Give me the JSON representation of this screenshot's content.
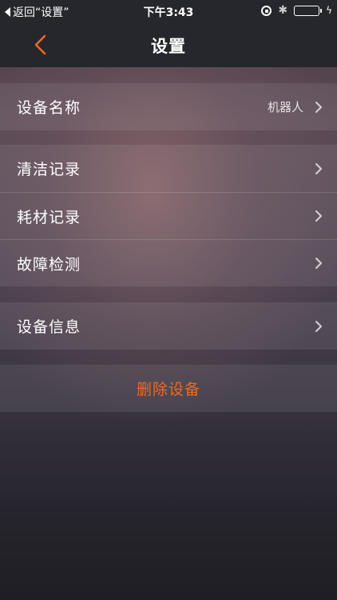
{
  "status_bar": {
    "back_text": "返回“设置”",
    "time": "下午3:43",
    "bluetooth_glyph": "✱",
    "charging_glyph": "ϟ"
  },
  "nav": {
    "title": "设置",
    "back_icon": "chevron-left-icon",
    "accent": "#ee6a22"
  },
  "groups": [
    {
      "rows": [
        {
          "label": "设备名称",
          "value": "机器人"
        }
      ]
    },
    {
      "rows": [
        {
          "label": "清洁记录"
        },
        {
          "label": "耗材记录"
        },
        {
          "label": "故障检测"
        }
      ]
    },
    {
      "rows": [
        {
          "label": "设备信息"
        }
      ]
    }
  ],
  "delete_label": "删除设备",
  "colors": {
    "battery": "#4cd964",
    "delete": "#ee6a22"
  }
}
